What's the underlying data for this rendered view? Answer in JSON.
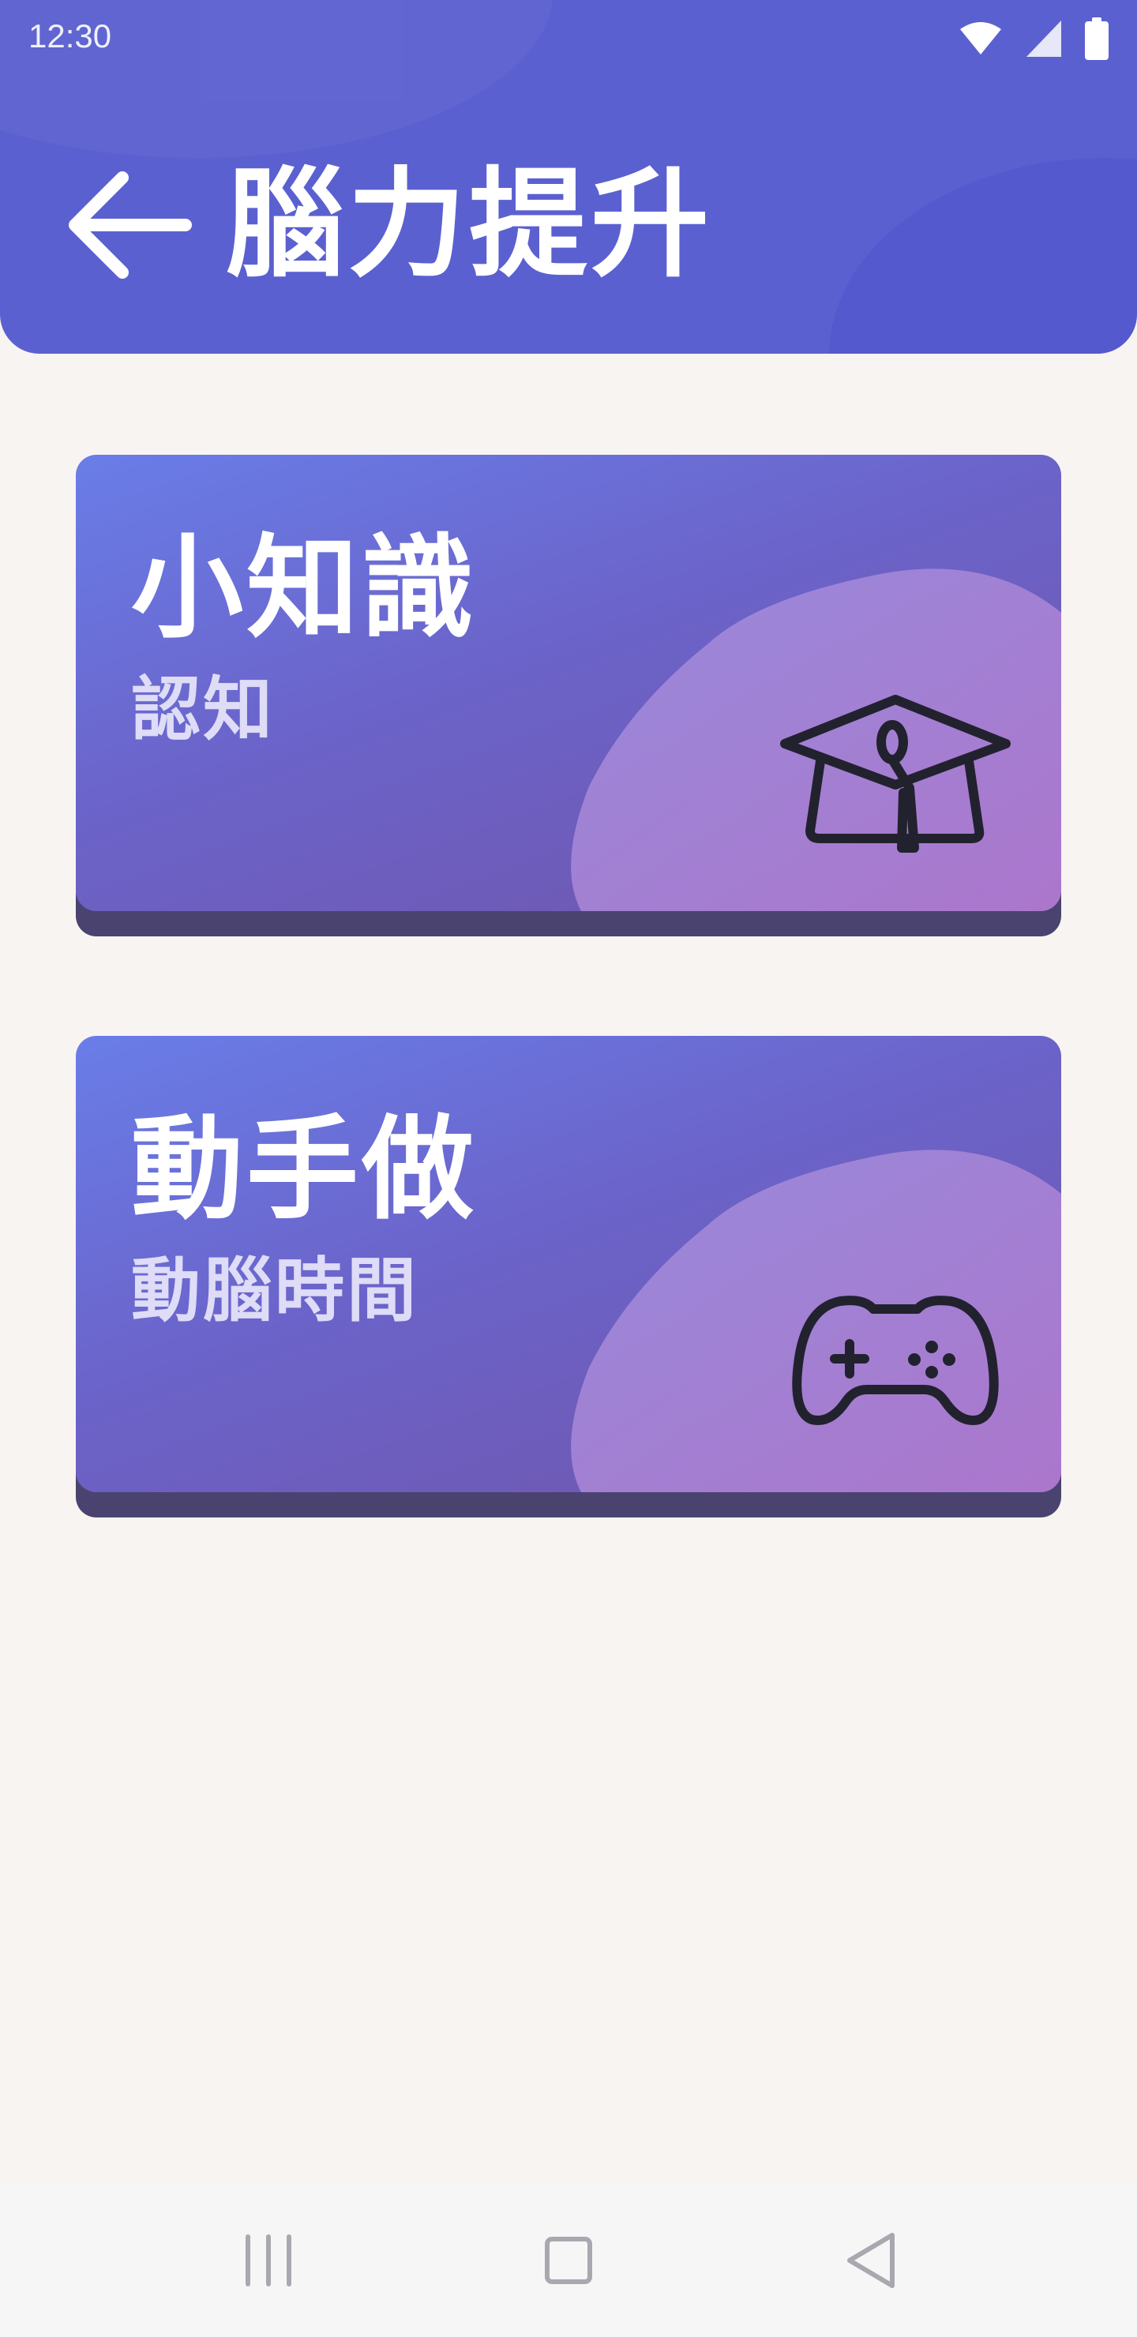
{
  "status_bar": {
    "time": "12:30",
    "icons": [
      "wifi-icon",
      "signal-icon",
      "battery-icon"
    ]
  },
  "header": {
    "title": "腦力提升",
    "back_icon": "arrow-left-icon",
    "color": "#5b60d0"
  },
  "cards": [
    {
      "title": "小知識",
      "subtitle": "認知",
      "icon": "graduation-cap-icon"
    },
    {
      "title": "動手做",
      "subtitle": "動腦時間",
      "icon": "gamepad-icon"
    }
  ],
  "nav_bar": {
    "icons": [
      "recents-icon",
      "home-icon",
      "back-triangle-icon"
    ]
  },
  "colors": {
    "background": "#f8f4f1",
    "card_gradient_start": "#6a7de8",
    "card_gradient_end": "#7155ab",
    "card_blob": "#a57fd6",
    "card_shadow": "#4a4370",
    "subtitle": "#dedcf6"
  }
}
